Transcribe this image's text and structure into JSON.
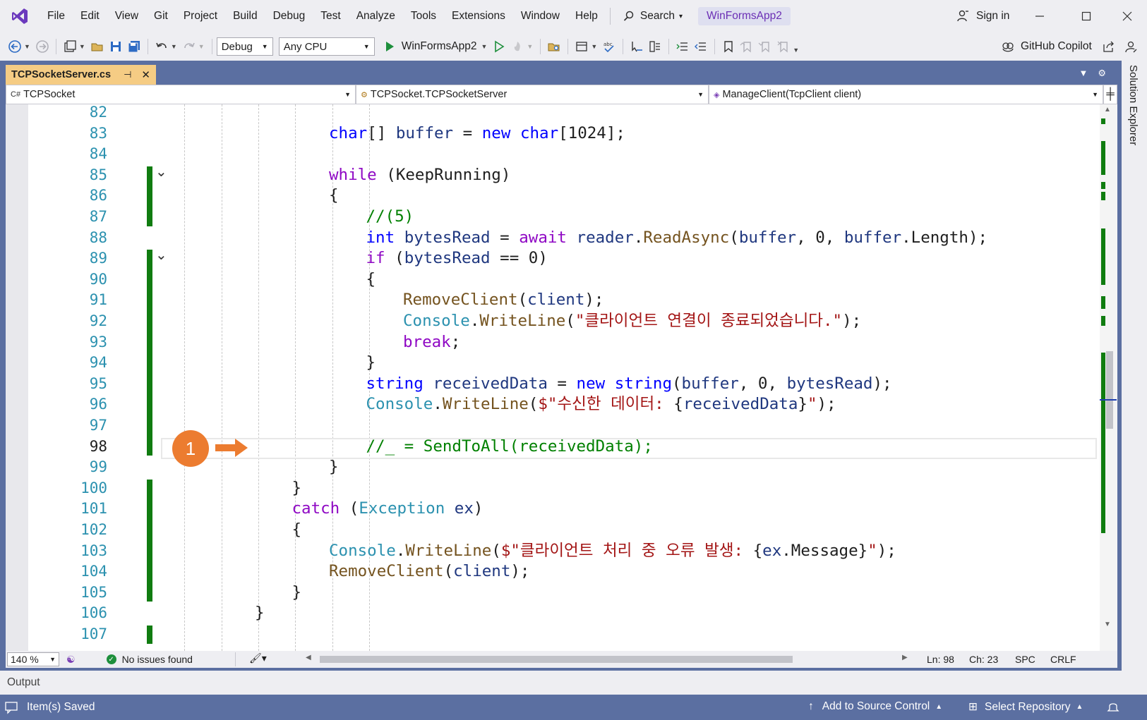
{
  "menu": {
    "items": [
      "File",
      "Edit",
      "View",
      "Git",
      "Project",
      "Build",
      "Debug",
      "Test",
      "Analyze",
      "Tools",
      "Extensions",
      "Window",
      "Help"
    ],
    "search_label": "Search",
    "project_name": "WinFormsApp2",
    "sign_in": "Sign in"
  },
  "toolbar": {
    "configuration": "Debug",
    "platform": "Any CPU",
    "run_target": "WinFormsApp2",
    "copilot_label": "GitHub Copilot"
  },
  "tab": {
    "filename": "TCPSocketServer.cs",
    "pin_glyph": "⊣",
    "close_glyph": "✕"
  },
  "nav": {
    "project": "TCPSocket",
    "type": "TCPSocket.TCPSocketServer",
    "member": "ManageClient(TcpClient client)"
  },
  "side_panel": {
    "solution_explorer": "Solution Explorer"
  },
  "editor": {
    "current_line": 98,
    "callout_number": "1",
    "lines": [
      {
        "n": "82",
        "indent": 0,
        "tokens": []
      },
      {
        "n": "83",
        "indent": 3,
        "tokens": [
          [
            "kw",
            "char"
          ],
          [
            "",
            "[] "
          ],
          [
            "var",
            "buffer"
          ],
          [
            "",
            " = "
          ],
          [
            "kw",
            "new"
          ],
          [
            "",
            " "
          ],
          [
            "kw",
            "char"
          ],
          [
            "",
            "[1024];"
          ]
        ]
      },
      {
        "n": "84",
        "indent": 0,
        "tokens": []
      },
      {
        "n": "85",
        "indent": 3,
        "tokens": [
          [
            "ctl",
            "while"
          ],
          [
            "",
            " (KeepRunning)"
          ]
        ]
      },
      {
        "n": "86",
        "indent": 3,
        "tokens": [
          [
            "",
            "{"
          ]
        ]
      },
      {
        "n": "87",
        "indent": 4,
        "tokens": [
          [
            "cmt",
            "//(5)"
          ]
        ]
      },
      {
        "n": "88",
        "indent": 4,
        "tokens": [
          [
            "kw",
            "int"
          ],
          [
            "",
            " "
          ],
          [
            "var",
            "bytesRead"
          ],
          [
            "",
            " = "
          ],
          [
            "ctl",
            "await"
          ],
          [
            "",
            " "
          ],
          [
            "var",
            "reader"
          ],
          [
            "",
            "."
          ],
          [
            "meth",
            "ReadAsync"
          ],
          [
            "",
            "("
          ],
          [
            "var",
            "buffer"
          ],
          [
            "",
            ", 0, "
          ],
          [
            "var",
            "buffer"
          ],
          [
            "",
            ".Length);"
          ]
        ]
      },
      {
        "n": "89",
        "indent": 4,
        "tokens": [
          [
            "ctl",
            "if"
          ],
          [
            "",
            " ("
          ],
          [
            "var",
            "bytesRead"
          ],
          [
            "",
            " == 0)"
          ]
        ]
      },
      {
        "n": "90",
        "indent": 4,
        "tokens": [
          [
            "",
            "{"
          ]
        ]
      },
      {
        "n": "91",
        "indent": 5,
        "tokens": [
          [
            "meth",
            "RemoveClient"
          ],
          [
            "",
            "("
          ],
          [
            "var",
            "client"
          ],
          [
            "",
            ");"
          ]
        ]
      },
      {
        "n": "92",
        "indent": 5,
        "tokens": [
          [
            "type",
            "Console"
          ],
          [
            "",
            "."
          ],
          [
            "meth",
            "WriteLine"
          ],
          [
            "",
            "("
          ],
          [
            "str",
            "\"클라이언트 연결이 종료되었습니다.\""
          ],
          [
            "",
            ");"
          ]
        ]
      },
      {
        "n": "93",
        "indent": 5,
        "tokens": [
          [
            "ctl",
            "break"
          ],
          [
            "",
            ";"
          ]
        ]
      },
      {
        "n": "94",
        "indent": 4,
        "tokens": [
          [
            "",
            "}"
          ]
        ]
      },
      {
        "n": "95",
        "indent": 4,
        "tokens": [
          [
            "kw",
            "string"
          ],
          [
            "",
            " "
          ],
          [
            "var",
            "receivedData"
          ],
          [
            "",
            " = "
          ],
          [
            "kw",
            "new"
          ],
          [
            "",
            " "
          ],
          [
            "kw",
            "string"
          ],
          [
            "",
            "("
          ],
          [
            "var",
            "buffer"
          ],
          [
            "",
            ", 0, "
          ],
          [
            "var",
            "bytesRead"
          ],
          [
            "",
            ");"
          ]
        ]
      },
      {
        "n": "96",
        "indent": 4,
        "tokens": [
          [
            "type",
            "Console"
          ],
          [
            "",
            "."
          ],
          [
            "meth",
            "WriteLine"
          ],
          [
            "",
            "("
          ],
          [
            "str",
            "$\"수신한 데이터: "
          ],
          [
            "",
            "{"
          ],
          [
            "var",
            "receivedData"
          ],
          [
            "",
            "}"
          ],
          [
            "str",
            "\""
          ],
          [
            "",
            ");"
          ]
        ]
      },
      {
        "n": "97",
        "indent": 0,
        "tokens": []
      },
      {
        "n": "98",
        "indent": 4,
        "tokens": [
          [
            "cmt",
            "//_ = SendToAll(receivedData);"
          ]
        ]
      },
      {
        "n": "99",
        "indent": 3,
        "tokens": [
          [
            "",
            "}"
          ]
        ]
      },
      {
        "n": "100",
        "indent": 2,
        "tokens": [
          [
            "",
            "}"
          ]
        ]
      },
      {
        "n": "101",
        "indent": 2,
        "tokens": [
          [
            "ctl",
            "catch"
          ],
          [
            "",
            " ("
          ],
          [
            "type",
            "Exception"
          ],
          [
            "",
            " "
          ],
          [
            "var",
            "ex"
          ],
          [
            "",
            ")"
          ]
        ]
      },
      {
        "n": "102",
        "indent": 2,
        "tokens": [
          [
            "",
            "{"
          ]
        ]
      },
      {
        "n": "103",
        "indent": 3,
        "tokens": [
          [
            "type",
            "Console"
          ],
          [
            "",
            "."
          ],
          [
            "meth",
            "WriteLine"
          ],
          [
            "",
            "("
          ],
          [
            "str",
            "$\"클라이언트 처리 중 오류 발생: "
          ],
          [
            "",
            "{"
          ],
          [
            "var",
            "ex"
          ],
          [
            "",
            ".Message}"
          ],
          [
            "str",
            "\""
          ],
          [
            "",
            ");"
          ]
        ]
      },
      {
        "n": "104",
        "indent": 3,
        "tokens": [
          [
            "meth",
            "RemoveClient"
          ],
          [
            "",
            "("
          ],
          [
            "var",
            "client"
          ],
          [
            "",
            ");"
          ]
        ]
      },
      {
        "n": "105",
        "indent": 2,
        "tokens": [
          [
            "",
            "}"
          ]
        ]
      },
      {
        "n": "106",
        "indent": 1,
        "tokens": [
          [
            "",
            "}"
          ]
        ]
      },
      {
        "n": "107",
        "indent": 0,
        "tokens": []
      }
    ]
  },
  "editor_status": {
    "zoom": "140 %",
    "issues": "No issues found",
    "ln": "Ln: 98",
    "ch": "Ch: 23",
    "whitespace": "SPC",
    "line_ending": "CRLF"
  },
  "output_label": "Output",
  "status_bar": {
    "message": "Item(s) Saved",
    "source_control": "Add to Source Control",
    "repository": "Select Repository"
  },
  "colors": {
    "accent": "#5b6fa1",
    "active_tab": "#f5cc84",
    "change_bar": "#107c10",
    "callout": "#ec7c30"
  }
}
